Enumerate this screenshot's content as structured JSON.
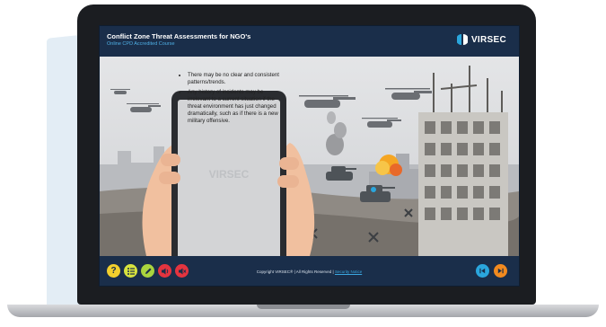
{
  "course": {
    "title": "Conflict Zone Threat Assessments for NGO's",
    "subtitle": "Online CPD Accredited Course"
  },
  "brand": {
    "name": "VIRSEC",
    "watermark": "VIRSEC",
    "colors": {
      "header": "#1a2e4a",
      "accent_blue": "#2aa6dd",
      "accent_orange": "#f18a1f"
    }
  },
  "phone": {
    "bullets": [
      "There may be no clear and consistent patterns/trends.",
      "Any history of incidents may be irrelevant to a current situation if the threat environment has just changed dramatically, such as if there is a new military offensive."
    ]
  },
  "footer": {
    "copyright": "Copyright VIRSEC® | All Rights Reserved |",
    "link": "Security Notice",
    "tools": [
      {
        "name": "help-button",
        "icon": "question-icon",
        "symbol": "?"
      },
      {
        "name": "menu-button",
        "icon": "list-icon"
      },
      {
        "name": "notes-button",
        "icon": "pencil-icon"
      },
      {
        "name": "audio-button",
        "icon": "speaker-icon"
      },
      {
        "name": "mute-button",
        "icon": "speaker-mute-icon"
      }
    ],
    "nav": {
      "prev_icon": "skip-back-icon",
      "next_icon": "skip-forward-icon"
    }
  }
}
